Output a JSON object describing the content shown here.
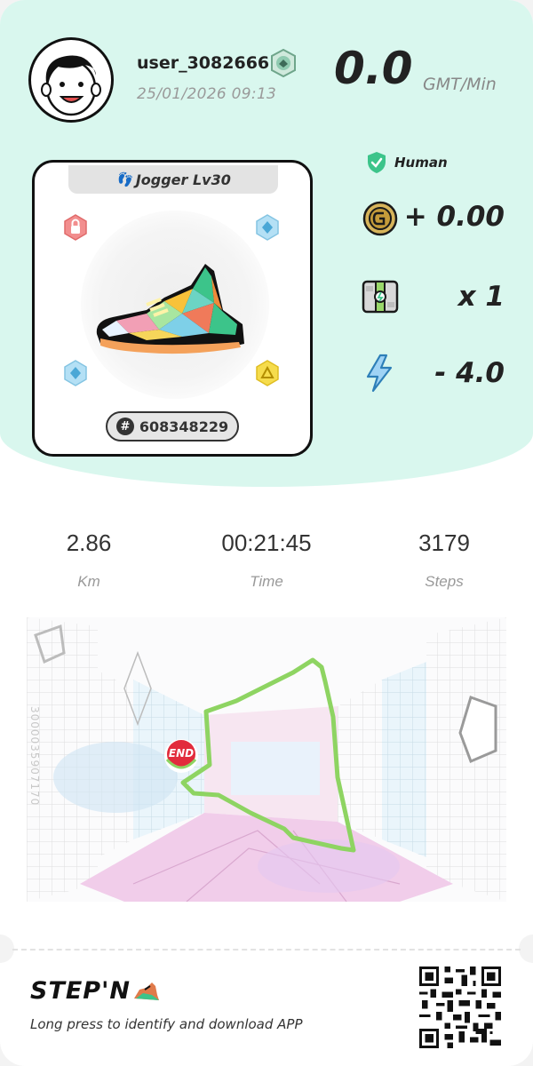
{
  "user": {
    "username": "user_3082666",
    "datetime": "25/01/2026 09:13"
  },
  "earnings": {
    "value": "0.0",
    "unit": "GMT/Min"
  },
  "sneaker": {
    "tag": "Jogger Lv30",
    "id": "608348229",
    "sockets": [
      {
        "name": "lock-socket",
        "color": "#f07a7a",
        "glyph": "🔒"
      },
      {
        "name": "diamond-socket",
        "color": "#9fd6f0",
        "glyph": "◆"
      },
      {
        "name": "diamond-socket",
        "color": "#9fd6f0",
        "glyph": "◆"
      },
      {
        "name": "triangle-socket",
        "color": "#f5d640",
        "glyph": "▲"
      }
    ]
  },
  "stats": {
    "human_label": "Human",
    "gmt_earned": "+ 0.00",
    "mystery_box": "x 1",
    "energy": "- 4.0"
  },
  "run": {
    "distance": "2.86",
    "distance_label": "Km",
    "time": "00:21:45",
    "time_label": "Time",
    "steps": "3179",
    "steps_label": "Steps"
  },
  "map": {
    "end_label": "END",
    "serial": "3000035907170",
    "route_color": "#8ed462"
  },
  "footer": {
    "brand": "STEP'N",
    "tagline": "Long press to identify and download APP"
  },
  "colors": {
    "header_bg": "#d9f7ee",
    "accent_green": "#3cc48a",
    "end_red": "#e22b3c"
  }
}
